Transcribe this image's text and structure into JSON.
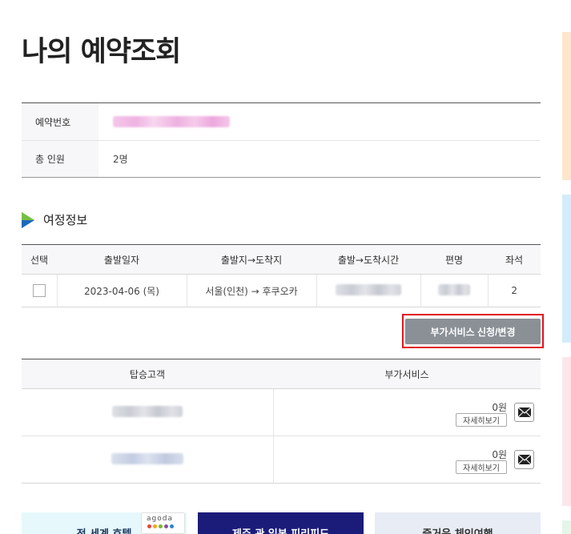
{
  "page": {
    "title": "나의 예약조회"
  },
  "reservation": {
    "number_label": "예약번호",
    "total_label": "총 인원",
    "total_value": "2명"
  },
  "itinerary": {
    "section_title": "여정정보",
    "headers": [
      "선택",
      "출발일자",
      "출발지→도착지",
      "출발→도착시간",
      "편명",
      "좌석"
    ],
    "rows": [
      {
        "date": "2023-04-06 (목)",
        "route": "서울(인천) → 후쿠오카",
        "seats": "2"
      }
    ]
  },
  "addon_button_label": "부가서비스 신청/변경",
  "passengers": {
    "headers": [
      "탑승고객",
      "부가서비스"
    ],
    "rows": [
      {
        "price": "0원",
        "detail_label": "자세히보기"
      },
      {
        "price": "0원",
        "detail_label": "자세히보기"
      }
    ]
  },
  "banners": {
    "banner1": "전 세계 호텔",
    "agoda": "agoda",
    "banner2": "제주 관 일본 피리피드",
    "banner3": "즐거운 체인여행"
  },
  "colors": {
    "highlight": "#e0141e",
    "addon_button": "#8a9096",
    "side_strips": [
      "#fde6cc",
      "#d3ecfb",
      "#fde6ea",
      "#e3f6e8"
    ]
  }
}
